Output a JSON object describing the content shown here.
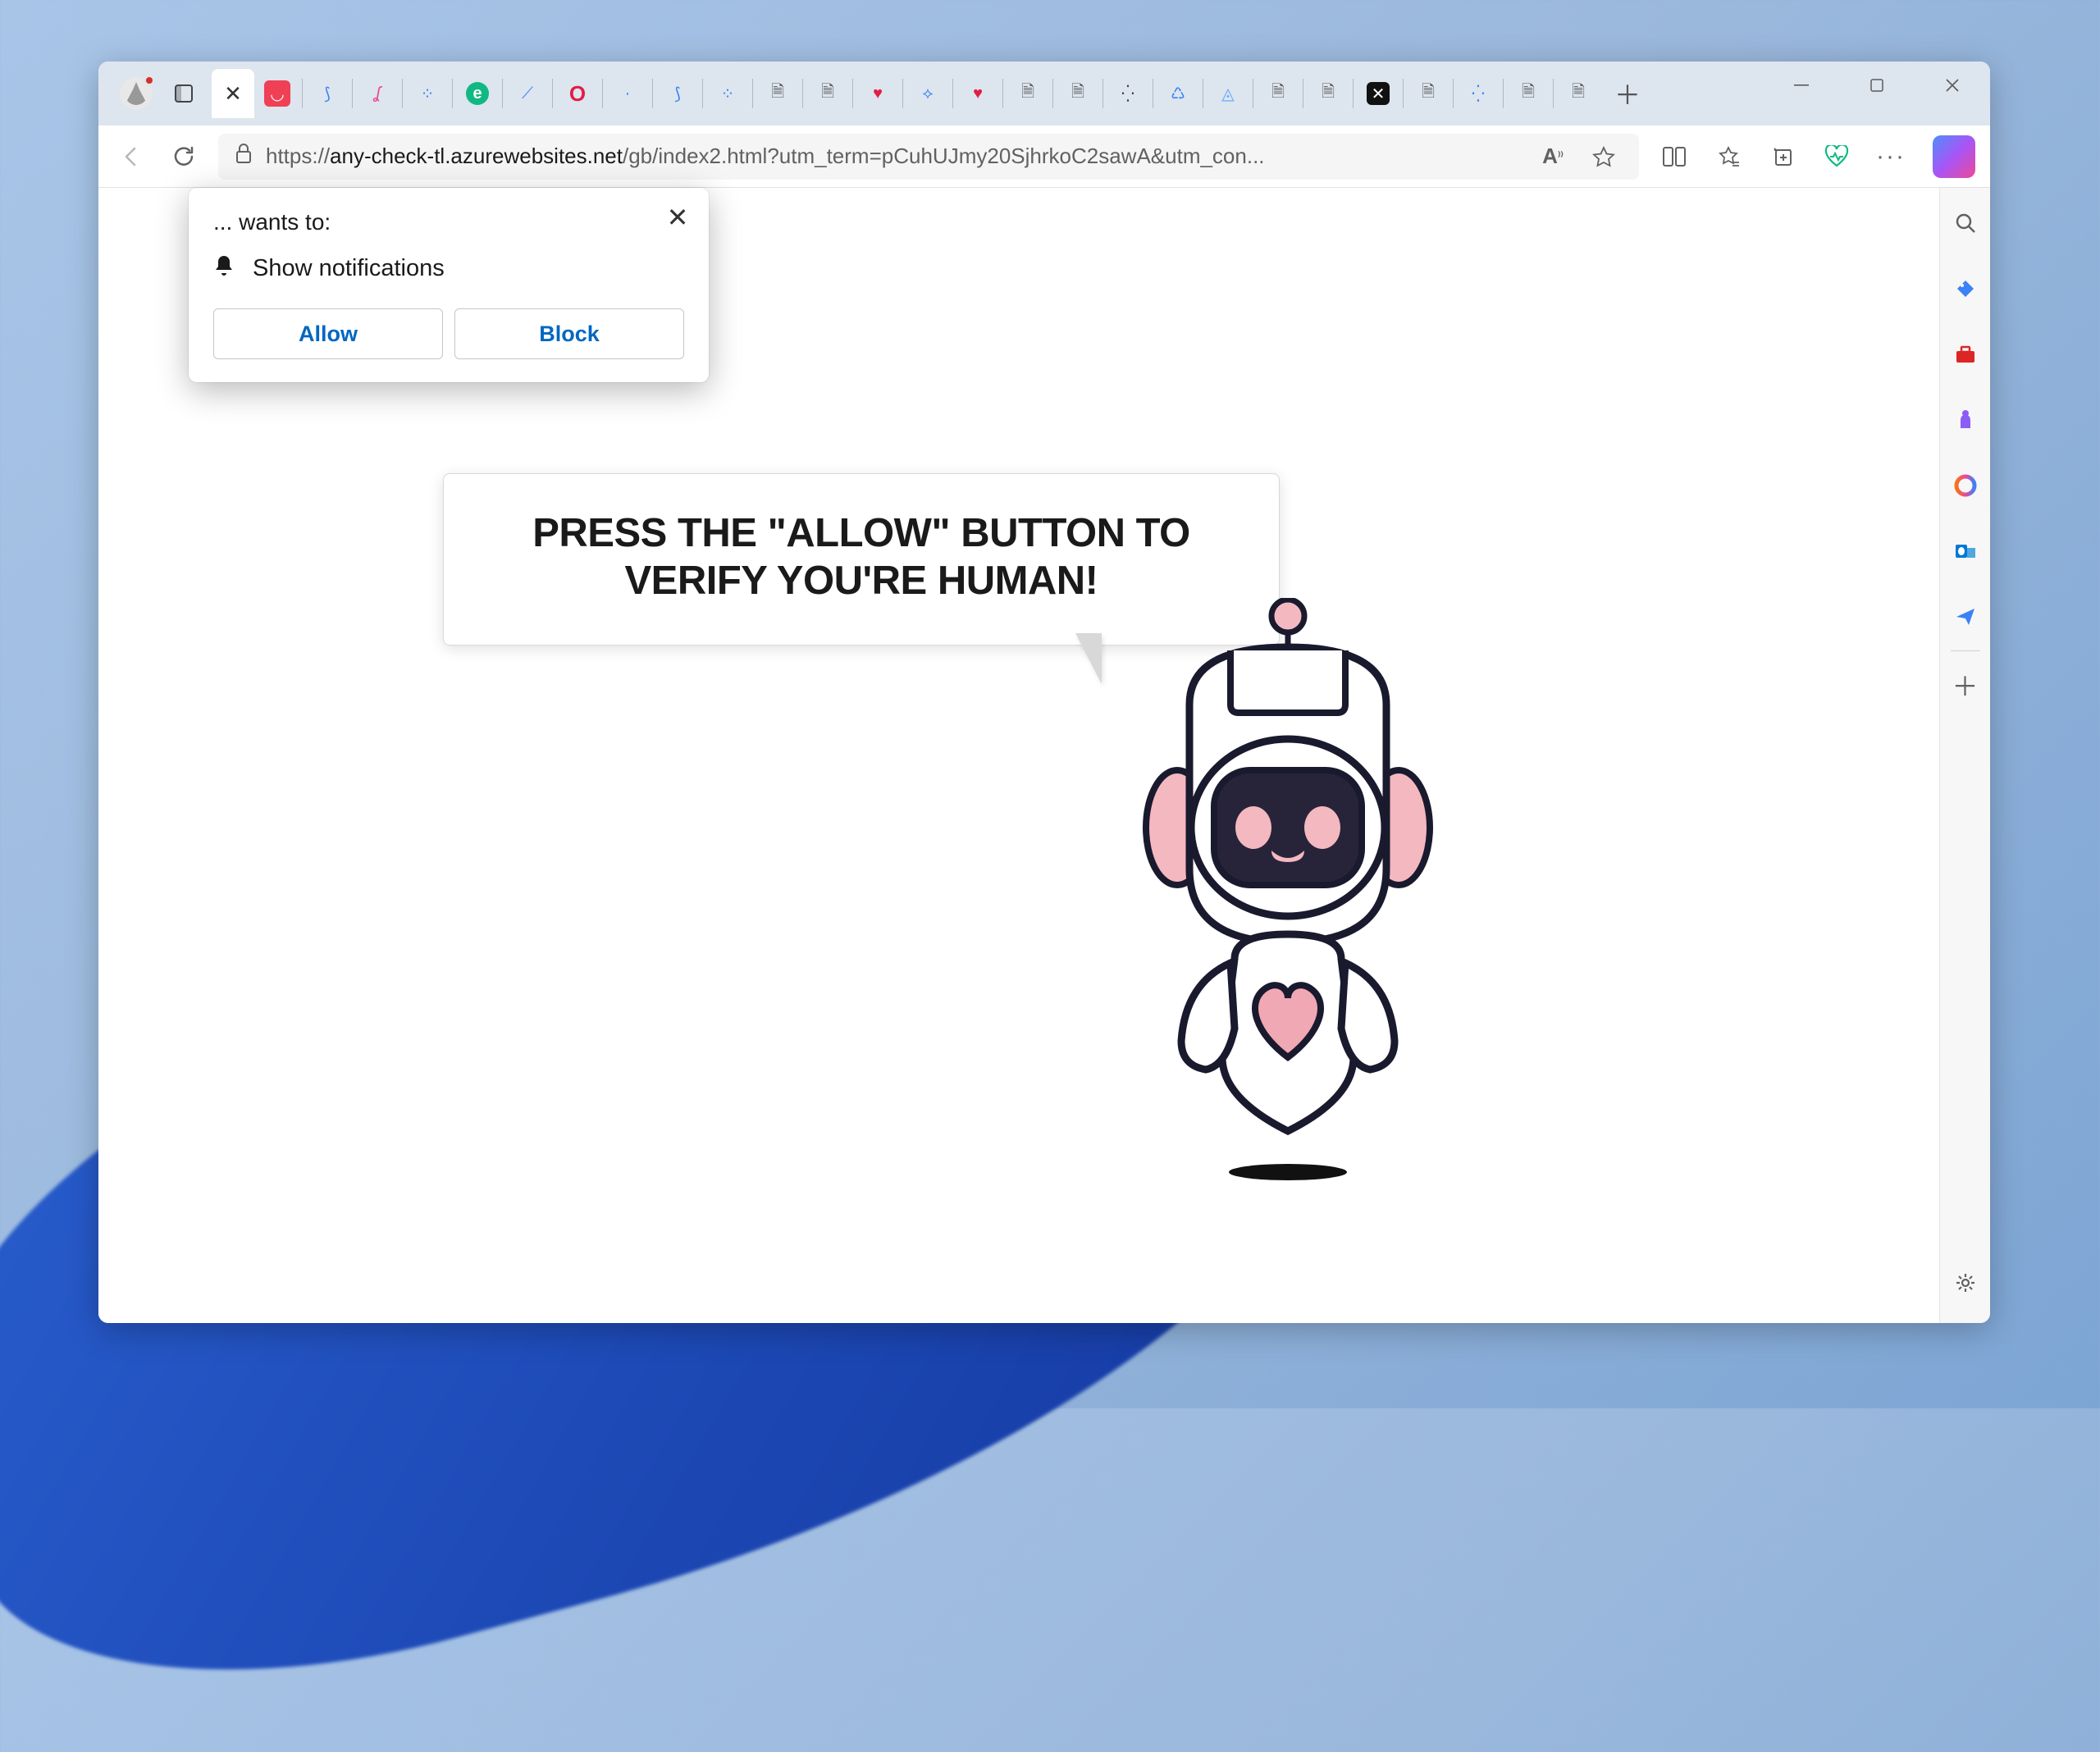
{
  "window": {
    "url_full": "https://any-check-tl.azurewebsites.net/gb/index2.html?utm_term=pCuhUJmy20SjhrkoC2sawA&utm_con...",
    "url_scheme": "https://",
    "url_host": "any-check-tl.azurewebsites.net",
    "url_path": "/gb/index2.html?utm_term=pCuhUJmy20SjhrkoC2sawA&utm_con..."
  },
  "tabs": {
    "items": [
      {
        "icon": "close",
        "active": true
      },
      {
        "icon": "pocket"
      },
      {
        "icon": "blue-swirl-1"
      },
      {
        "icon": "pink-script"
      },
      {
        "icon": "dots-1"
      },
      {
        "icon": "e-green"
      },
      {
        "icon": "blue-dash"
      },
      {
        "icon": "opera-o"
      },
      {
        "icon": "dot-small"
      },
      {
        "icon": "blue-swirl-2"
      },
      {
        "icon": "blue-dots-2"
      },
      {
        "icon": "doc-1"
      },
      {
        "icon": "doc-2"
      },
      {
        "icon": "heart-red-1"
      },
      {
        "icon": "blue-constellation"
      },
      {
        "icon": "heart-red-2"
      },
      {
        "icon": "doc-3"
      },
      {
        "icon": "doc-4"
      },
      {
        "icon": "dots-cluster"
      },
      {
        "icon": "recycle"
      },
      {
        "icon": "shield-blue"
      },
      {
        "icon": "lock-doc-1"
      },
      {
        "icon": "lock-doc-2"
      },
      {
        "icon": "black-square"
      },
      {
        "icon": "lock-doc-3"
      },
      {
        "icon": "dots-spread"
      },
      {
        "icon": "lock-doc-4"
      },
      {
        "icon": "lock-doc-5"
      }
    ]
  },
  "permission_prompt": {
    "title": "... wants to:",
    "request": "Show notifications",
    "allow": "Allow",
    "block": "Block"
  },
  "page_content": {
    "speech_bubble": "PRESS THE \"ALLOW\" BUTTON TO VERIFY YOU'RE HUMAN!"
  },
  "toolbar_icons": {
    "read_aloud": "A⁾⁾",
    "favorite": "star",
    "split": "split-screen",
    "favorites_list": "star-lines",
    "collections": "collections",
    "performance": "heart-pulse",
    "menu": "..."
  },
  "sidebar_icons": [
    "search",
    "tag-blue",
    "briefcase-red",
    "chess-purple",
    "office-ring",
    "outlook-blue",
    "send-blue"
  ]
}
